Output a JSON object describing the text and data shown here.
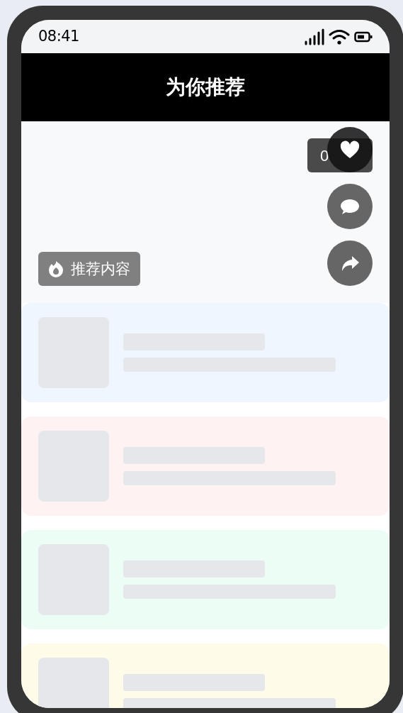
{
  "status_bar": {
    "time": "08:41"
  },
  "header": {
    "title": "为你推荐"
  },
  "video": {
    "timer": "0",
    "tag": "推荐内容",
    "actions": [
      {
        "kind": "like"
      },
      {
        "kind": "comment"
      },
      {
        "kind": "share"
      }
    ]
  },
  "cards": [
    {
      "color": "#eff6ff"
    },
    {
      "color": "#fef2f2"
    },
    {
      "color": "#ecfdf5"
    },
    {
      "color": "#fefce8"
    }
  ]
}
